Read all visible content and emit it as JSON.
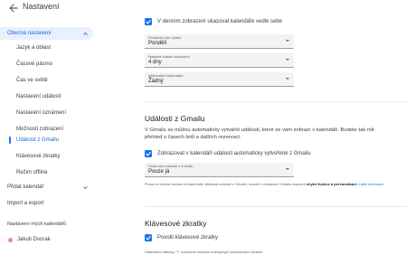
{
  "header": {
    "title": "Nastavení"
  },
  "sidebar": {
    "general": {
      "label": "Obecná nastavení"
    },
    "sub_items": [
      {
        "label": "Jazyk a oblast"
      },
      {
        "label": "Časové pásmo"
      },
      {
        "label": "Čas ve světě"
      },
      {
        "label": "Nastavení událostí"
      },
      {
        "label": "Nastavení oznámení"
      },
      {
        "label": "Možnosti zobrazení"
      },
      {
        "label": "Události z Gmailu"
      },
      {
        "label": "Klávesové zkratky"
      },
      {
        "label": "Režim offline"
      }
    ],
    "add_calendar": {
      "label": "Přidat kalendář"
    },
    "import_export": {
      "label": "Import a export"
    },
    "my_calendars_header": "Nastavení mých kalendářů",
    "calendar_owner": {
      "label": "Jakub Dvorak",
      "color": "#f28b82"
    }
  },
  "main": {
    "side_by_side": {
      "label": "V denním zobrazení ukazovat kalendáře vedle sebe",
      "checked": true
    },
    "week_start": {
      "label": "Počáteční den týdne",
      "value": "Pondělí"
    },
    "custom_view": {
      "label": "Nastavit vlastní zobrazení",
      "value": "4 dny"
    },
    "alt_calendar": {
      "label": "Alternativní kalendáře",
      "value": "Žádný"
    },
    "gmail": {
      "title": "Události z Gmailu",
      "description": "V Gmailu se můžou automaticky vytvářet události, které se vám zobrazí v kalendáři. Budete tak mít přehled o časech letů a dalších rezervací.",
      "auto_checkbox": {
        "label": "Zobrazovat v kalendáři události automaticky vytvořené z Gmailu",
        "checked": true
      },
      "privacy": {
        "label": "Soukromí událostí z e-mailu",
        "value": "Pouze já"
      },
      "note_prefix": "Pokud si chcete nechat do kalendáře přidávat události z Gmailu, musíte v nastavení Gmailu zapnout",
      "note_bold": "chytré funkce a personalizaci.",
      "note_link": "Další informace"
    },
    "shortcuts": {
      "title": "Klávesové zkratky",
      "enable_checkbox": {
        "label": "Povolit klávesové zkratky",
        "checked": true
      },
      "hint": "Stisknutím klávesy \"?\" zobrazíte seznam dostupných klávesových zkratek"
    }
  },
  "colors": {
    "accent": "#1a73e8",
    "active_bg": "#e8f0fe",
    "active_text": "#1967d2"
  }
}
